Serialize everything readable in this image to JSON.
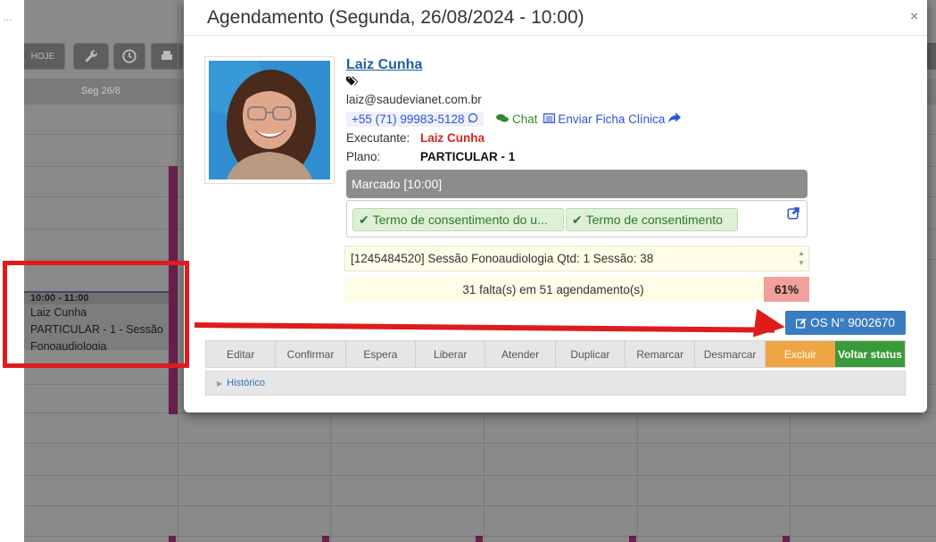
{
  "background": {
    "left_mark": "...",
    "toolbar": {
      "today_label": "HOJE"
    },
    "day_header": "Seg 26/8",
    "event": {
      "time": "10:00 - 11:00",
      "line1": "Laiz Cunha",
      "line2": "PARTICULAR - 1 - Sessão",
      "line3": "Fonoaudiologia"
    }
  },
  "modal": {
    "title": "Agendamento (Segunda, 26/08/2024 - 10:00)",
    "close": "×",
    "patient": {
      "name": "Laiz Cunha",
      "tags_icon": "tags-icon",
      "email": "laiz@saudevianet.com.br",
      "phone": "+55 (71) 99983-5128",
      "chat_label": "Chat",
      "ficha_label": "Enviar Ficha Clínica",
      "executante_label": "Executante:",
      "executante_value": "Laiz Cunha",
      "plano_label": "Plano:",
      "plano_value": "PARTICULAR - 1"
    },
    "status": "Marcado [10:00]",
    "terms": [
      "Termo de consentimento do u...",
      "Termo de consentimento"
    ],
    "session": "[1245484520] Sessão Fonoaudiologia Qtd: 1 Sessão: 38",
    "faltas": {
      "text": "31 falta(s) em 51 agendamento(s)",
      "percent": "61%"
    },
    "os_button": "OS N° 9002670",
    "actions": [
      "Editar",
      "Confirmar",
      "Espera",
      "Liberar",
      "Atender",
      "Duplicar",
      "Remarcar",
      "Desmarcar",
      "Excluir",
      "Voltar status"
    ],
    "historico": "Histórico"
  },
  "colors": {
    "excluir": "#efa544",
    "voltar_status": "#3a9a3a",
    "os_button": "#3a7cc0",
    "annotation": "#e01b1b"
  }
}
